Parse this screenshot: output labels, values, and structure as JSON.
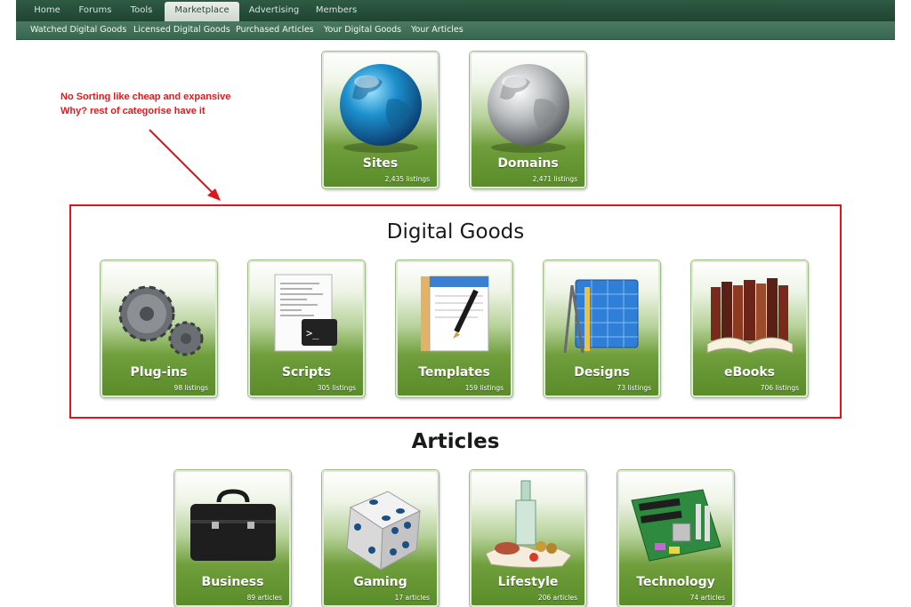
{
  "nav": {
    "tabs": [
      {
        "label": "Home"
      },
      {
        "label": "Forums"
      },
      {
        "label": "Tools"
      },
      {
        "label": "Marketplace"
      },
      {
        "label": "Advertising"
      },
      {
        "label": "Members"
      }
    ],
    "active_tab": "Marketplace",
    "subtabs": [
      {
        "label": "Watched Digital Goods"
      },
      {
        "label": "Licensed Digital Goods"
      },
      {
        "label": "Purchased Articles"
      },
      {
        "label": "Your Digital Goods"
      },
      {
        "label": "Your Articles"
      }
    ]
  },
  "annotation": {
    "line1": "No Sorting like cheap and expansive",
    "line2": "Why? rest of categorise have it",
    "color": "#e0151b"
  },
  "top_categories": [
    {
      "name": "Sites",
      "count": "2,435 listings",
      "icon": "globe-blue-icon"
    },
    {
      "name": "Domains",
      "count": "2,471 listings",
      "icon": "globe-silver-icon"
    }
  ],
  "digital_goods": {
    "title": "Digital Goods",
    "items": [
      {
        "name": "Plug-ins",
        "count": "98 listings",
        "icon": "gears-icon"
      },
      {
        "name": "Scripts",
        "count": "305 listings",
        "icon": "terminal-document-icon"
      },
      {
        "name": "Templates",
        "count": "159 listings",
        "icon": "pen-document-icon"
      },
      {
        "name": "Designs",
        "count": "73 listings",
        "icon": "blueprint-compass-icon"
      },
      {
        "name": "eBooks",
        "count": "706 listings",
        "icon": "books-icon"
      }
    ]
  },
  "articles": {
    "title": "Articles",
    "items": [
      {
        "name": "Business",
        "count": "89 articles",
        "icon": "briefcase-icon"
      },
      {
        "name": "Gaming",
        "count": "17 articles",
        "icon": "dice-icon"
      },
      {
        "name": "Lifestyle",
        "count": "206 articles",
        "icon": "food-bottle-icon"
      },
      {
        "name": "Technology",
        "count": "74 articles",
        "icon": "motherboard-icon"
      }
    ]
  },
  "colors": {
    "nav_dark": "#1e4432",
    "tile_green": "#5a8c2a",
    "highlight_red": "#e0151b"
  }
}
